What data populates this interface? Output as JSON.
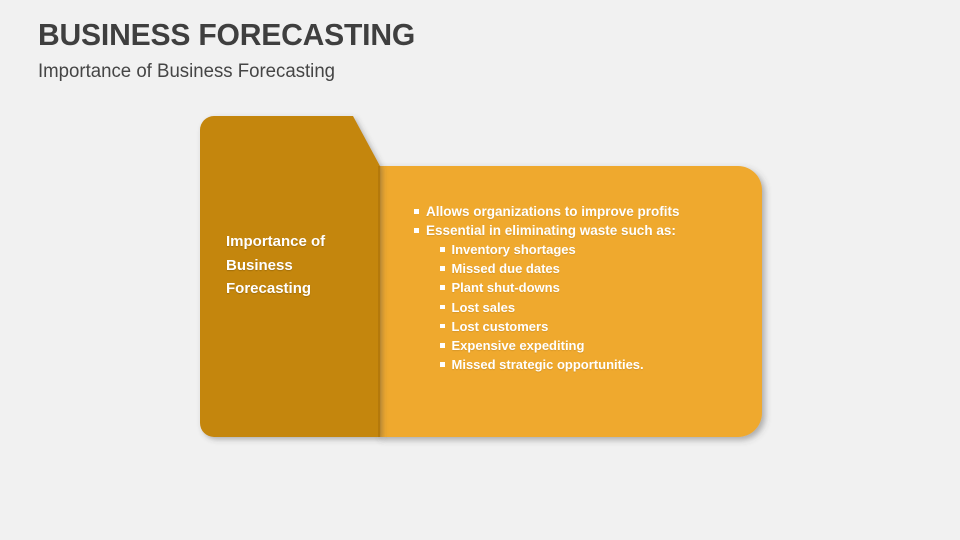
{
  "slide": {
    "title": "BUSINESS FORECASTING",
    "subtitle": "Importance of Business Forecasting",
    "background_color": "#f1f1f1",
    "title_color": "#3f3f3f"
  },
  "diagram": {
    "left_panel": {
      "color": "#c4860f",
      "label_lines": [
        "Importance of",
        "Business",
        "Forecasting"
      ]
    },
    "right_panel": {
      "color": "#efa92e",
      "bullets": [
        {
          "level": 1,
          "text": "Allows organizations to improve profits",
          "marker": "square-bullet"
        },
        {
          "level": 1,
          "text": "Essential in eliminating waste such as:",
          "marker": "square-bullet"
        },
        {
          "level": 2,
          "text": "Inventory shortages",
          "marker": "square-bullet"
        },
        {
          "level": 2,
          "text": "Missed due dates",
          "marker": "square-bullet"
        },
        {
          "level": 2,
          "text": "Plant shut-downs",
          "marker": "square-bullet"
        },
        {
          "level": 2,
          "text": "Lost sales",
          "marker": "square-bullet"
        },
        {
          "level": 2,
          "text": "Lost customers",
          "marker": "square-bullet"
        },
        {
          "level": 2,
          "text": "Expensive expediting",
          "marker": "square-bullet"
        },
        {
          "level": 2,
          "text": "Missed strategic opportunities.",
          "marker": "square-bullet"
        }
      ]
    }
  }
}
